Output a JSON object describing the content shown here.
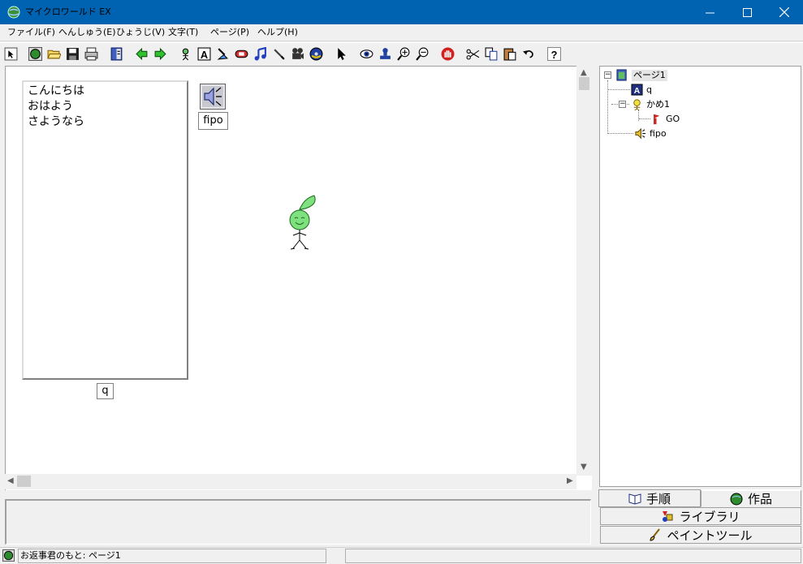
{
  "window": {
    "title": "マイクロワールド EX",
    "controls": {
      "minimize": "—",
      "maximize": "☐",
      "close": "✕"
    }
  },
  "menu": [
    {
      "label": "ファイル(F)"
    },
    {
      "label": "へんしゅう(E)"
    },
    {
      "label": "ひょうじ(V)"
    },
    {
      "label": "文字(T)"
    },
    {
      "label": "ページ(P)"
    },
    {
      "label": "ヘルプ(H)"
    }
  ],
  "toolbar": {
    "icons": [
      "pointer-small-icon",
      "globe-icon",
      "open-folder-icon",
      "save-icon",
      "print-icon",
      "book-icon",
      "back-arrow-icon",
      "forward-arrow-icon",
      "new-turtle-icon",
      "text-box-icon",
      "paint-icon",
      "button-icon",
      "music-icon",
      "edit-pen-icon",
      "video-icon",
      "cd-icon",
      "select-arrow-icon",
      "eye-icon",
      "stamp-icon",
      "zoom-in-icon",
      "zoom-out-icon",
      "stop-hand-icon",
      "cut-icon",
      "copy-icon",
      "paste-icon",
      "undo-icon",
      "help-icon"
    ]
  },
  "canvas": {
    "list_lines": [
      "こんにちは",
      "おはよう",
      "さようなら"
    ],
    "list_caption": "q",
    "sound_caption": "fipo"
  },
  "tree": {
    "page": "ページ1",
    "q": "q",
    "turtle": "かめ1",
    "go": "GO",
    "fipo": "fipo"
  },
  "tabs": {
    "steps": "手順",
    "works": "作品",
    "library": "ライブラリ",
    "paint_tools": "ペイントツール"
  },
  "status": {
    "text": "お返事君のもと: ページ1"
  },
  "colors": {
    "titlebar": "#0063b1",
    "turtle_green": "#7ee07e"
  }
}
